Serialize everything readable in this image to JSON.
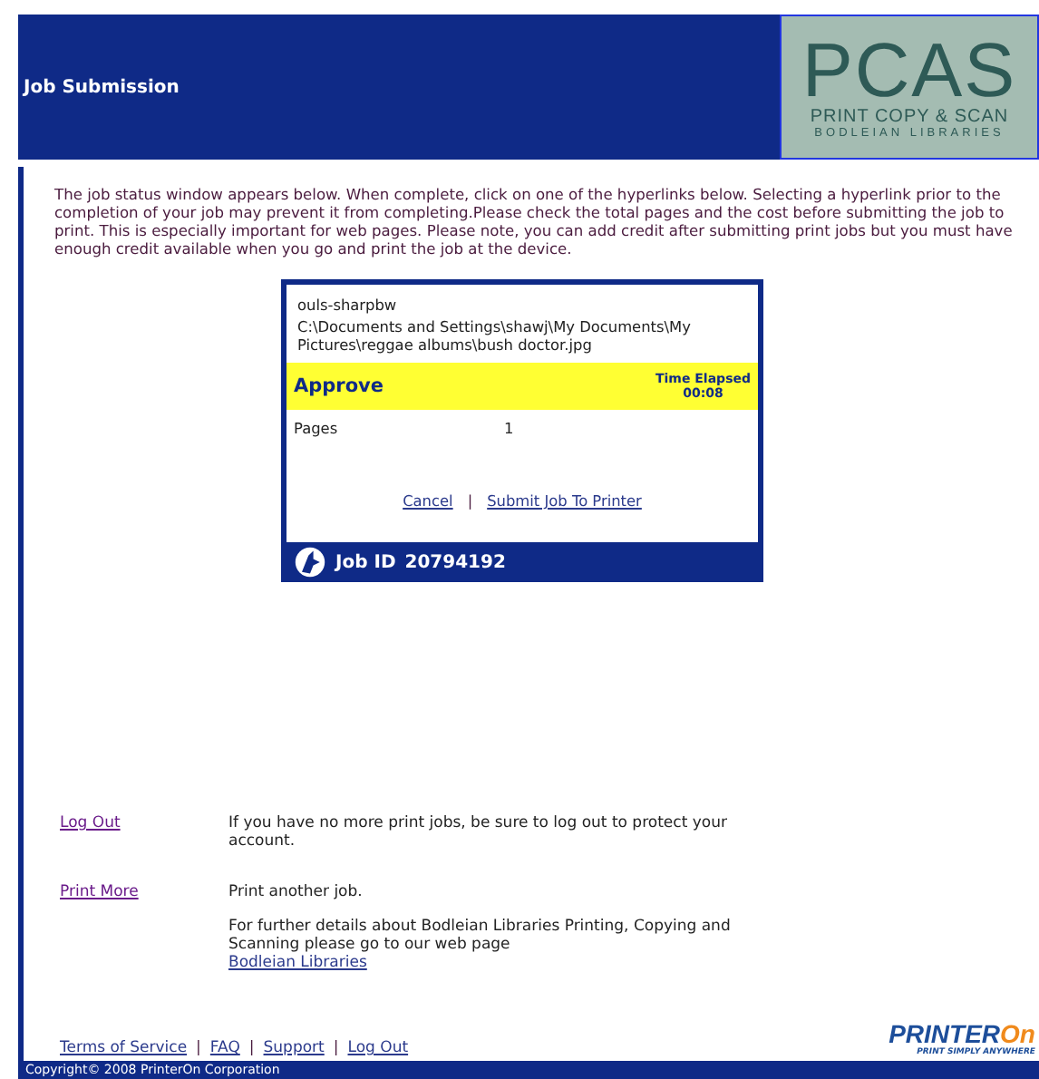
{
  "header": {
    "title": "Job Submission",
    "logo": {
      "big": "PCAS",
      "line1": "PRINT COPY & SCAN",
      "line2": "BODLEIAN LIBRARIES"
    }
  },
  "intro": "The job status window appears below. When complete, click on one of the hyperlinks below. Selecting a hyperlink prior to the completion of your job may prevent it from completing.Please check the total pages and the cost before submitting the job to print. This is especially important for web pages. Please note, you can add credit after submitting print jobs but you must have enough credit available when you go and print the job at the device.",
  "job": {
    "printer": "ouls-sharpbw",
    "file": "C:\\Documents and Settings\\shawj\\My Documents\\My Pictures\\reggae albums\\bush doctor.jpg",
    "status": "Approve",
    "elapsed_label": "Time Elapsed",
    "elapsed": "00:08",
    "pages_label": "Pages",
    "pages": "1",
    "actions": [
      "Cancel",
      "Submit Job To Printer"
    ],
    "separator": "|",
    "job_id_label": "Job ID",
    "job_id": "20794192"
  },
  "options": [
    {
      "link": "Log Out",
      "texts": [
        "If you have no more print jobs, be sure to log out to protect your account."
      ]
    },
    {
      "link": "Print More",
      "texts": [
        "Print another job.",
        "For further details about Bodleian Libraries Printing, Copying and Scanning please go to our web page"
      ],
      "web_link": "Bodleian Libraries"
    }
  ],
  "footer_links": [
    "Terms of Service",
    "FAQ",
    "Support",
    "Log Out"
  ],
  "footer_separator": "|",
  "brand": {
    "name": "PRINTER",
    "accent": "On",
    "tagline": "PRINT SIMPLY ANYWHERE"
  },
  "copyright": "Copyright© 2008 PrinterOn Corporation"
}
